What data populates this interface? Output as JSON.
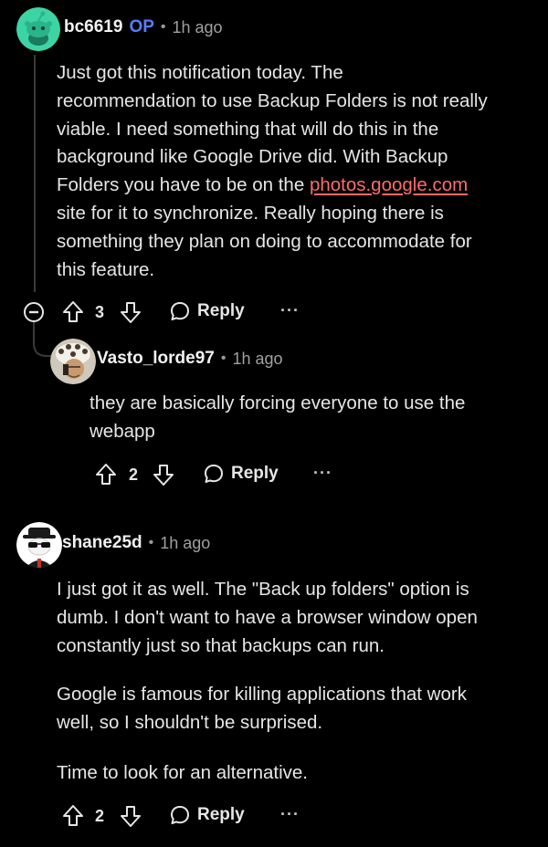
{
  "comments": [
    {
      "username": "bc6619",
      "op_badge": "OP",
      "separator": "•",
      "time": "1h ago",
      "text_lines": [
        "Just got this notification today. The",
        "recommendation to use Backup Folders is not really",
        "viable. I need something that will do this in the",
        "background like Google Drive did. With Backup",
        "site for it to synchronize. Really hoping there is",
        "something they plan on doing to accommodate for",
        "this feature."
      ],
      "link_line_prefix": "Folders you have to be on the ",
      "link_text": "photos.google.com",
      "vote_count": "3",
      "reply_label": "Reply",
      "more_label": "···"
    },
    {
      "username": "Vasto_lorde97",
      "separator": "•",
      "time": "1h ago",
      "text_lines": [
        "they are basically forcing everyone to use the",
        "webapp"
      ],
      "vote_count": "2",
      "reply_label": "Reply",
      "more_label": "···"
    },
    {
      "username": "shane25d",
      "separator": "•",
      "time": "1h ago",
      "text_lines": [
        "I just got it as well. The \"Back up folders\" option is",
        "dumb. I don't want to have a browser window open",
        "constantly just so that backups can run.",
        "Google is famous for killing applications that work",
        "well, so I shouldn't be surprised.",
        "Time to look for an alternative."
      ],
      "vote_count": "2",
      "reply_label": "Reply",
      "more_label": "···"
    }
  ],
  "icons": {
    "collapse": "minus-circle-icon",
    "upvote": "arrow-up-icon",
    "downvote": "arrow-down-icon",
    "reply": "speech-bubble-icon",
    "more": "ellipsis-icon"
  },
  "colors": {
    "background": "#000000",
    "op_badge": "#5a7bff",
    "link": "#ff6b6b",
    "thread_line": "#3a3a3a",
    "avatar_1": "#3dd4a5"
  }
}
